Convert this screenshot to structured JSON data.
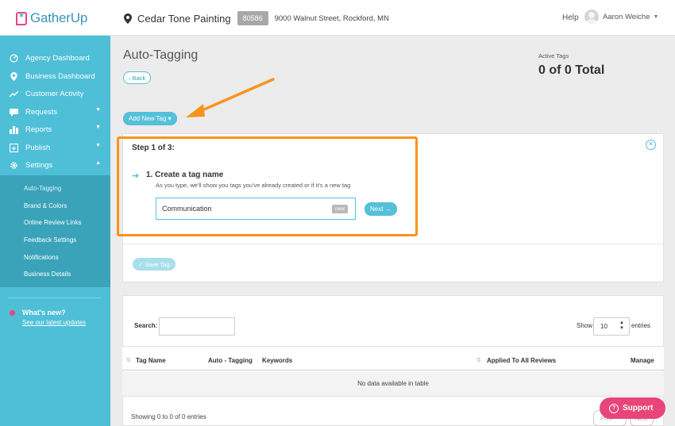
{
  "brand": {
    "name": "GatherUp",
    "accent": "#4fbfd8",
    "highlight": "#f7941d",
    "pink": "#e8457a"
  },
  "header": {
    "business_name": "Cedar Tone Painting",
    "business_id": "80586",
    "address": "9000 Walnut Street, Rockford, MN",
    "help": "Help",
    "user_name": "Aaron Weiche"
  },
  "sidebar": {
    "items": [
      {
        "label": "Agency Dashboard",
        "icon": "gauge-icon"
      },
      {
        "label": "Business Dashboard",
        "icon": "location-pin-icon"
      },
      {
        "label": "Customer Activity",
        "icon": "trend-line-icon"
      },
      {
        "label": "Requests",
        "icon": "chat-icon"
      },
      {
        "label": "Reports",
        "icon": "bar-chart-icon"
      },
      {
        "label": "Publish",
        "icon": "publish-icon"
      },
      {
        "label": "Settings",
        "icon": "gear-icon"
      }
    ],
    "settings_sub": [
      "Auto-Tagging",
      "Brand & Colors",
      "Online Review Links",
      "Feedback Settings",
      "Notifications",
      "Business Details"
    ],
    "whats_new": {
      "title": "What's new?",
      "link": "See our latest updates"
    }
  },
  "main": {
    "title": "Auto-Tagging",
    "back": "‹ Back",
    "active_tags_label": "Active Tags",
    "active_tags_value": "0 of 0 Total",
    "add_new_tag": "Add New Tag ▾",
    "step": "Step 1 of 3:",
    "step_title": "1. Create a tag name",
    "step_hint": "As you type, we'll show you tags you've already created or if it's a new tag",
    "tag_input_value": "Communication",
    "new_badge": "new",
    "next": "Next →",
    "save_tag": "✓ Save Tag"
  },
  "table": {
    "search_label": "Search:",
    "show_label": "Show",
    "entries_value": "10",
    "entries_label": "entries",
    "columns": [
      "Tag Name",
      "Auto - Tagging",
      "Keywords",
      "Applied To All Reviews",
      "Manage"
    ],
    "empty": "No data available in table",
    "showing": "Showing 0 to 0 of 0 entries",
    "prev": "Prev",
    "next": "Next"
  },
  "support": "Support"
}
